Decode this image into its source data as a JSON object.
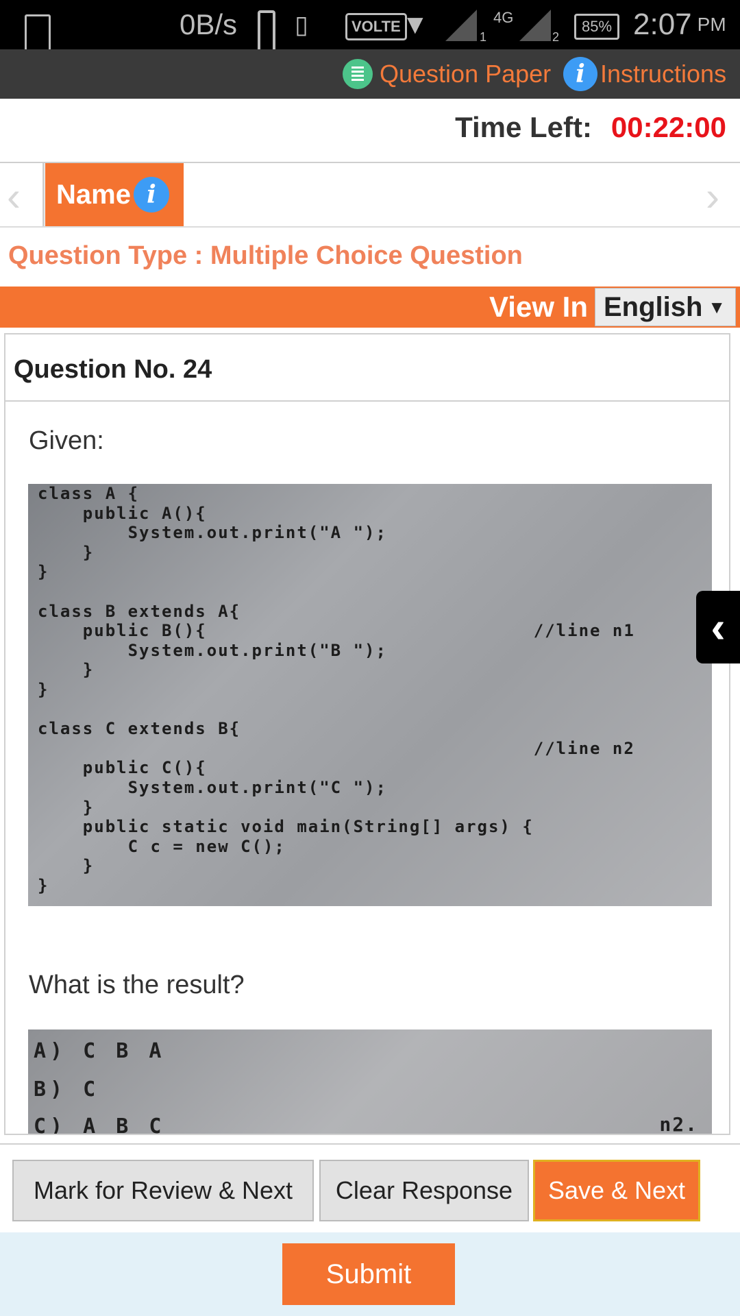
{
  "status_bar": {
    "speed": "0B/s",
    "volte": "VOLTE",
    "network": "4G",
    "sim1": "1",
    "sim2": "2",
    "battery": "85%",
    "time": "2:07",
    "ampm": "PM"
  },
  "top_bar": {
    "question_paper_label": "Question Paper",
    "instructions_label": "Instructions",
    "info_glyph": "i"
  },
  "timer": {
    "label": "Time Left:",
    "value": "00:22:00",
    "value_color": "#e8131a"
  },
  "section": {
    "name_tab": "Name",
    "info_glyph": "i"
  },
  "question_type": "Question Type : Multiple Choice Question",
  "language": {
    "view_in_label": "View In",
    "selected": "English"
  },
  "question": {
    "number_label": "Question No. 24",
    "intro": "Given:",
    "code": "class A {\n    public A(){\n        System.out.print(\"A \");\n    }\n}\n\nclass B extends A{\n    public B(){                             //line n1\n        System.out.print(\"B \");\n    }\n}\n\nclass C extends B{\n                                            //line n2\n    public C(){\n        System.out.print(\"C \");\n    }\n    public static void main(String[] args) {\n        C c = new C();\n    }\n}",
    "prompt": "What is the result?",
    "options": [
      "A) C B A",
      "B) C",
      "C) A B C"
    ],
    "options_tail": "n2."
  },
  "actions": {
    "mark_review": "Mark for Review & Next",
    "clear": "Clear Response",
    "save_next": "Save & Next",
    "submit": "Submit"
  },
  "colors": {
    "accent": "#f47330",
    "top_bar": "#3a3a3a",
    "info_blue": "#3d9cf5",
    "submit_area": "#e3f1f8"
  },
  "icons": [
    "image-icon",
    "phone-icon",
    "vibrate-icon",
    "wifi-icon",
    "signal-icon",
    "battery-icon",
    "question-paper-icon",
    "info-icon",
    "chevron-left-icon",
    "chevron-right-icon",
    "dropdown-caret-icon",
    "collapse-panel-icon"
  ]
}
